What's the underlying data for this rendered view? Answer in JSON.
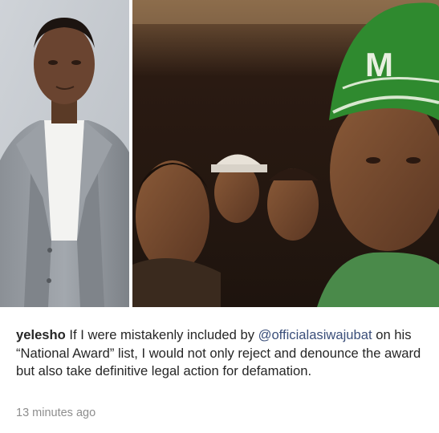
{
  "post": {
    "username": "yelesho",
    "caption_before": " If I were mistakenly included by ",
    "mention": "@officialasiwajubat",
    "caption_after": " on his “National Award” list, I would not only reject and denounce the award but also take definitive legal action for defamation.",
    "timestamp": "13 minutes ago",
    "cap_letter": "M"
  },
  "colors": {
    "caption_text": "#262626",
    "mention": "#3b4f7a",
    "timestamp": "#8e8e8e",
    "cap_green": "#2f8a2f"
  }
}
